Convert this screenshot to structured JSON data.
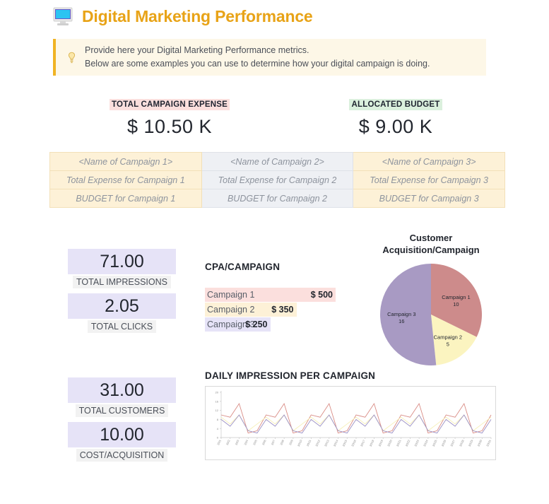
{
  "header": {
    "title": "Digital Marketing Performance",
    "icon": "monitor-icon"
  },
  "note": {
    "icon": "lightbulb-icon",
    "line1": "Provide here your Digital Marketing Performance metrics.",
    "line2": "Below are some examples you can use to determine how your digital campaign is doing."
  },
  "headline": {
    "expense_label": "TOTAL CAMPAIGN EXPENSE",
    "expense_value": "$ 10.50 K",
    "budget_label": "ALLOCATED BUDGET",
    "budget_value": "$ 9.00 K"
  },
  "campaign_table": {
    "rows": [
      [
        "<Name of Campaign 1>",
        "<Name of Campaign 2>",
        "<Name of Campaign 3>"
      ],
      [
        "Total Expense for Campaign 1",
        "Total Expense for Campaign 2",
        "Total Expense for Campaign 3"
      ],
      [
        "BUDGET for Campaign 1",
        "BUDGET for Campaign 2",
        "BUDGET for Campaign 3"
      ]
    ]
  },
  "kpis": [
    {
      "value": "71.00",
      "label": "TOTAL IMPRESSIONS"
    },
    {
      "value": "2.05",
      "label": "TOTAL CLICKS"
    },
    {
      "value": "31.00",
      "label": "TOTAL CUSTOMERS"
    },
    {
      "value": "10.00",
      "label": "COST/ACQUISITION"
    }
  ],
  "cpa": {
    "title": "CPA/CAMPAIGN",
    "rows": [
      {
        "name": "Campaign 1",
        "amount": "$ 500",
        "value": 500,
        "color": "#fbdfdd"
      },
      {
        "name": "Campaign 2",
        "amount": "$ 350",
        "value": 350,
        "color": "#fdf1d7"
      },
      {
        "name": "Campaign 3",
        "amount": "$ 250",
        "value": 250,
        "color": "#e6e3f7"
      }
    ]
  },
  "chart_data": [
    {
      "id": "cpa-bars",
      "type": "bar",
      "title": "CPA/CAMPAIGN",
      "orientation": "horizontal",
      "categories": [
        "Campaign 1",
        "Campaign 2",
        "Campaign 3"
      ],
      "values": [
        500,
        350,
        250
      ],
      "value_labels": [
        "$ 500",
        "$ 350",
        "$ 250"
      ],
      "colors": [
        "#fbdfdd",
        "#fdf1d7",
        "#e6e3f7"
      ],
      "xlabel": "",
      "ylabel": "",
      "xlim": [
        0,
        500
      ],
      "grid": false,
      "legend": "none"
    },
    {
      "id": "customer-acquisition-pie",
      "type": "pie",
      "title": "Customer Acquisition/Campaign",
      "labels": [
        "Campaign 1",
        "Campaign 2",
        "Campaign 3"
      ],
      "values": [
        10,
        5,
        16
      ],
      "total": 31,
      "colors": [
        "#cd8b8b",
        "#fbf4c0",
        "#a89ac3"
      ],
      "legend": "none",
      "data_labels": true,
      "start_angle_deg": 0,
      "direction": "clockwise"
    },
    {
      "id": "daily-impression-per-campaign",
      "type": "line",
      "title": "DAILY IMPRESSION PER CAMPAIGN",
      "xlabel": "",
      "ylabel": "",
      "ylim": [
        0,
        20
      ],
      "yticks": [
        0,
        4,
        8,
        12,
        16,
        20
      ],
      "grid": false,
      "legend": "none",
      "x": [
        "30/1",
        "30/2",
        "30/3",
        "30/4",
        "30/5",
        "30/6",
        "30/7",
        "30/8",
        "30/9",
        "30/10",
        "30/11",
        "30/12",
        "30/13",
        "30/14",
        "30/15",
        "30/16",
        "30/17",
        "30/18",
        "30/19",
        "30/20",
        "30/21",
        "30/22",
        "30/23",
        "30/24",
        "30/25",
        "30/26",
        "30/27",
        "30/28",
        "30/29",
        "30/30",
        "30/31"
      ],
      "series": [
        {
          "name": "Campaign 1",
          "color": "#d98b84",
          "values": [
            10,
            9,
            15,
            2,
            3,
            10,
            9,
            15,
            2,
            3,
            10,
            9,
            15,
            2,
            3,
            10,
            9,
            15,
            2,
            3,
            10,
            9,
            15,
            2,
            3,
            10,
            9,
            15,
            2,
            3,
            10
          ]
        },
        {
          "name": "Campaign 2",
          "color": "#f6efb5",
          "values": [
            9,
            6,
            10,
            3,
            6,
            9,
            6,
            10,
            3,
            6,
            9,
            6,
            10,
            3,
            6,
            9,
            6,
            10,
            3,
            6,
            9,
            6,
            10,
            3,
            6,
            9,
            6,
            10,
            3,
            6,
            9
          ]
        },
        {
          "name": "Campaign 3",
          "color": "#9a8fc4",
          "values": [
            8,
            5,
            10,
            3,
            2,
            8,
            5,
            10,
            3,
            2,
            8,
            5,
            10,
            3,
            2,
            8,
            5,
            10,
            3,
            2,
            8,
            5,
            10,
            3,
            2,
            8,
            5,
            10,
            3,
            2,
            8
          ]
        }
      ]
    }
  ],
  "colors": {
    "title": "#e8a317",
    "banner_bg": "#fdf7e7",
    "banner_accent": "#f0b323",
    "kpi_value_bg": "#e6e3f7",
    "kpi_label_bg": "#f2f2f2",
    "expense_badge_bg": "#fbdfdd",
    "budget_badge_bg": "#dbf0dd",
    "table_cream": "#fdf1d7",
    "table_gray": "#eef0f4"
  }
}
